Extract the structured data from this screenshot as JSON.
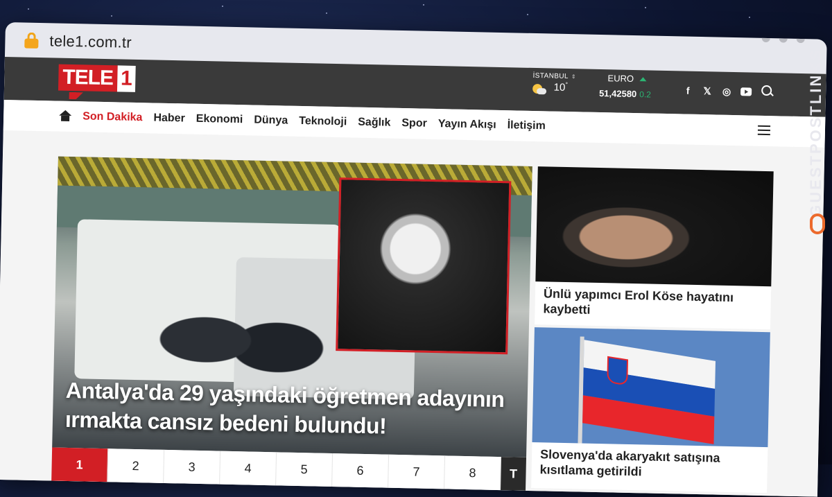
{
  "browser": {
    "url": "tele1.com.tr"
  },
  "brand": {
    "logo_word": "TELE",
    "logo_number": "1",
    "accent": "#d21f25"
  },
  "weather": {
    "city": "İSTANBUL",
    "temperature": "10",
    "degree": "°"
  },
  "currency": {
    "name": "EURO",
    "value": "51,42580",
    "change": "0.2"
  },
  "social": {
    "icons": [
      "facebook-icon",
      "x-icon",
      "instagram-icon",
      "youtube-icon"
    ],
    "facebook_glyph": "f",
    "x_glyph": "𝕏",
    "instagram_glyph": "◎"
  },
  "nav": {
    "items": [
      "Son Dakika",
      "Haber",
      "Ekonomi",
      "Dünya",
      "Teknoloji",
      "Sağlık",
      "Spor",
      "Yayın Akışı",
      "İletişim"
    ]
  },
  "hero": {
    "title": "Antalya'da 29 yaşındaki öğretmen adayının ırmakta cansız bedeni bulundu!"
  },
  "pager": {
    "pages": [
      "1",
      "2",
      "3",
      "4",
      "5",
      "6",
      "7",
      "8"
    ],
    "last": "T"
  },
  "side": {
    "story1": "Ünlü yapımcı Erol Köse hayatını kaybetti",
    "story2": "Slovenya'da akaryakıt satışına kısıtlama getirildi"
  },
  "watermark": {
    "text": "GUESTPOSTLINKS"
  }
}
